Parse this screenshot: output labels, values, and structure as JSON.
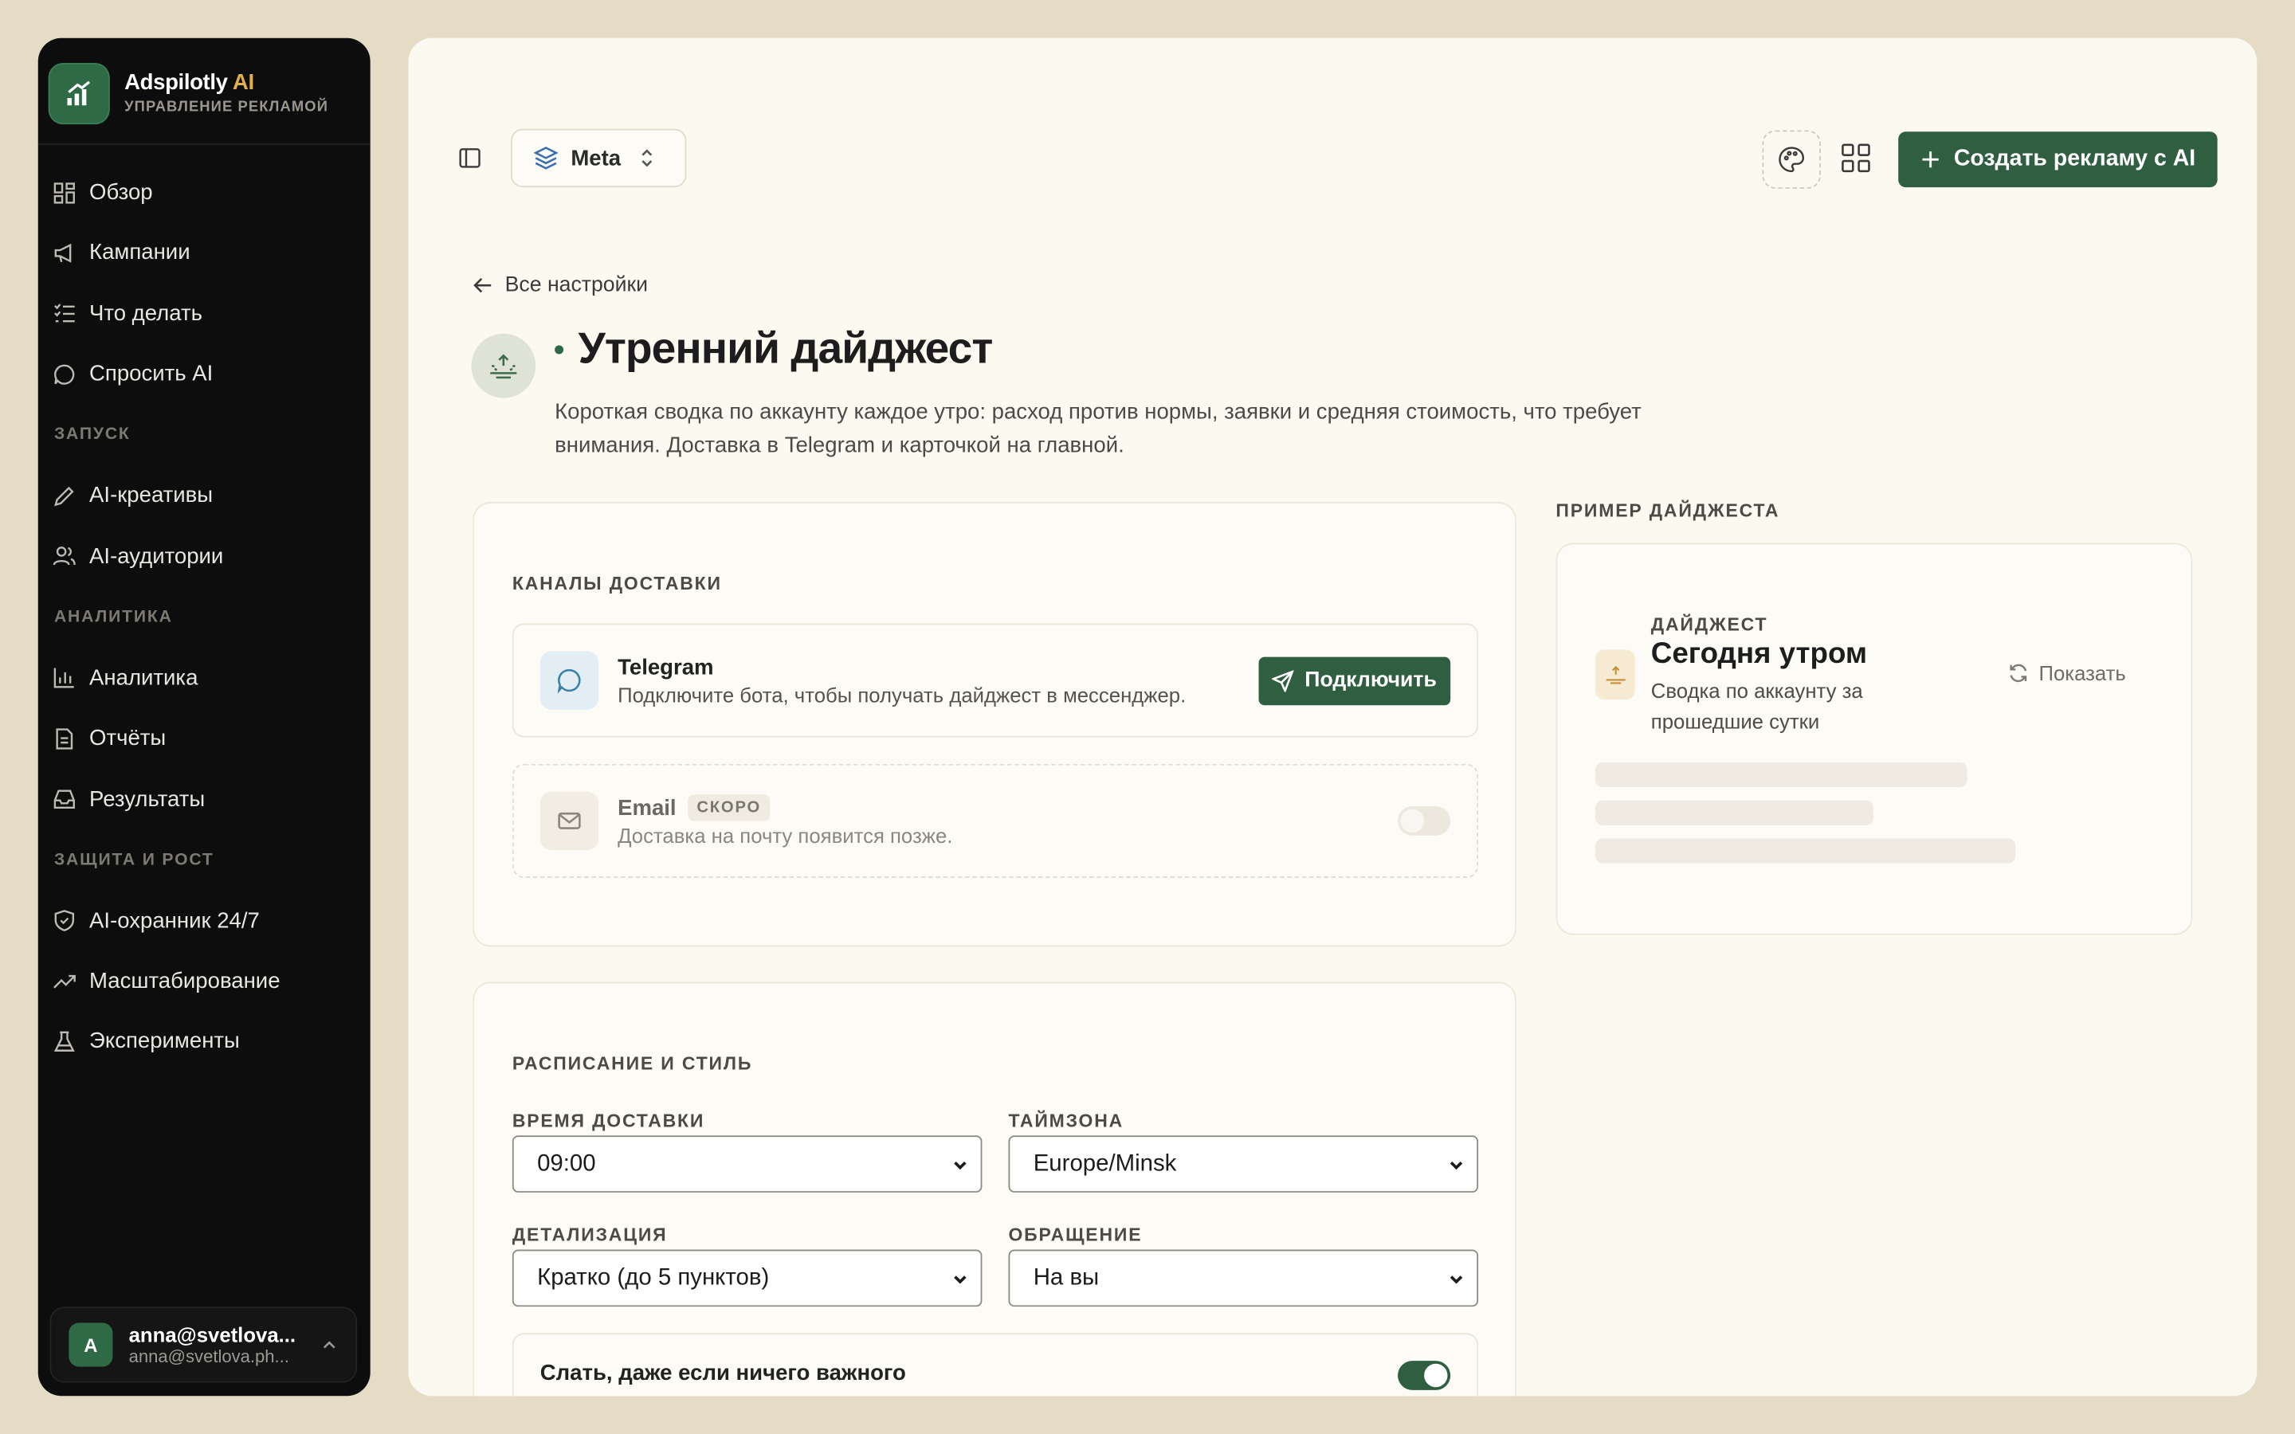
{
  "brand": {
    "name": "Adspilotly",
    "ai": "AI",
    "subtitle": "УПРАВЛЕНИЕ РЕКЛАМОЙ"
  },
  "sidebar": {
    "main_items": [
      {
        "label": "Обзор",
        "icon": "dashboard-icon"
      },
      {
        "label": "Кампании",
        "icon": "megaphone-icon"
      },
      {
        "label": "Что делать",
        "icon": "checklist-icon"
      },
      {
        "label": "Спросить AI",
        "icon": "chat-icon"
      }
    ],
    "sections": [
      {
        "title": "ЗАПУСК",
        "items": [
          {
            "label": "AI-креативы",
            "icon": "pencil-icon"
          },
          {
            "label": "AI-аудитории",
            "icon": "users-icon"
          }
        ]
      },
      {
        "title": "АНАЛИТИКА",
        "items": [
          {
            "label": "Аналитика",
            "icon": "bar-chart-icon"
          },
          {
            "label": "Отчёты",
            "icon": "document-icon"
          },
          {
            "label": "Результаты",
            "icon": "inbox-icon"
          }
        ]
      },
      {
        "title": "ЗАЩИТА И РОСТ",
        "items": [
          {
            "label": "AI-охранник 24/7",
            "icon": "shield-icon"
          },
          {
            "label": "Масштабирование",
            "icon": "trend-up-icon"
          },
          {
            "label": "Эксперименты",
            "icon": "flask-icon"
          }
        ]
      }
    ]
  },
  "user": {
    "initial": "A",
    "name": "anna@svetlova...",
    "email": "anna@svetlova.ph..."
  },
  "topbar": {
    "platform": "Meta",
    "create_label": "Создать рекламу с AI"
  },
  "page": {
    "back_label": "Все настройки",
    "title": "Утренний дайджест",
    "description": "Короткая сводка по аккаунту каждое утро: расход против нормы, заявки и средняя стоимость, что требует внимания. Доставка в Telegram и карточкой на главной."
  },
  "delivery": {
    "title": "КАНАЛЫ ДОСТАВКИ",
    "telegram": {
      "name": "Telegram",
      "description": "Подключите бота, чтобы получать дайджест в мессенджер.",
      "button": "Подключить"
    },
    "email": {
      "name": "Email",
      "badge": "СКОРО",
      "description": "Доставка на почту появится позже.",
      "enabled": false
    }
  },
  "schedule": {
    "title": "РАСПИСАНИЕ И СТИЛЬ",
    "time_label": "ВРЕМЯ ДОСТАВКИ",
    "time_value": "09:00",
    "tz_label": "ТАЙМЗОНА",
    "tz_value": "Europe/Minsk",
    "detail_label": "ДЕТАЛИЗАЦИЯ",
    "detail_value": "Кратко (до 5 пунктов)",
    "address_label": "ОБРАЩЕНИЕ",
    "address_value": "На вы",
    "always_send_label": "Слать, даже если ничего важного",
    "always_send": true
  },
  "preview": {
    "section_label": "ПРИМЕР ДАЙДЖЕСТА",
    "kicker": "ДАЙДЖЕСТ",
    "title": "Сегодня утром",
    "subtitle": "Сводка по аккаунту за прошедшие сутки",
    "show_label": "Показать"
  },
  "colors": {
    "accent": "#2f5e40",
    "sidebar_bg": "#0d0d0d",
    "page_bg": "#fcf9f1"
  }
}
